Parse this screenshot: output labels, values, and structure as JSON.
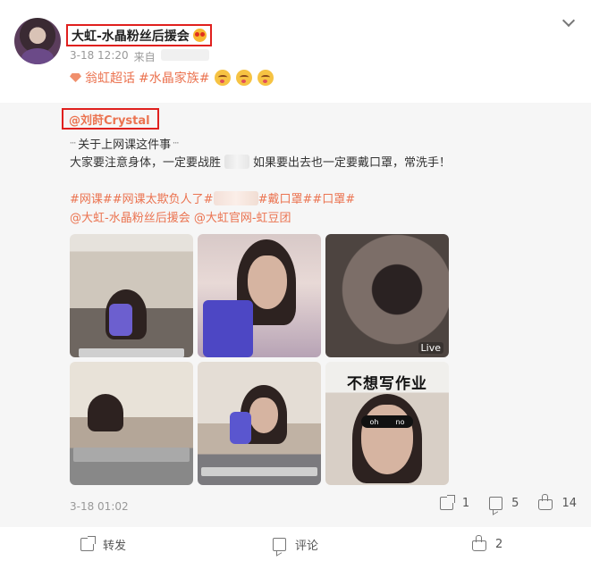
{
  "post": {
    "author": "大虹-水晶粉丝后援会",
    "time": "3-18 12:20",
    "source_prefix": "来自",
    "topics": [
      "翁虹超话",
      "#水晶家族#"
    ]
  },
  "retweet": {
    "author": "@刘莳Crystal",
    "line1": "关于上网课这件事",
    "line2_a": "大家要注意身体，一定要战胜",
    "line2_b": "如果要出去也一定要戴口罩，常洗手！",
    "tags1_a": "#网课##网课太欺负人了#",
    "tags1_b": "#戴口罩##口罩#",
    "mentions": "@大虹-水晶粉丝后援会 @大虹官网-虹豆团",
    "photo_caption": "不想写作业",
    "live_label": "Live",
    "glasses_l": "oh",
    "glasses_r": "no",
    "time": "3-18 01:02",
    "reposts": "1",
    "comments": "5",
    "likes": "14"
  },
  "footer": {
    "repost_label": "转发",
    "comment_label": "评论",
    "likes": "2"
  },
  "colors": {
    "accent": "#eb7350",
    "highlight_border": "#e0201e"
  }
}
